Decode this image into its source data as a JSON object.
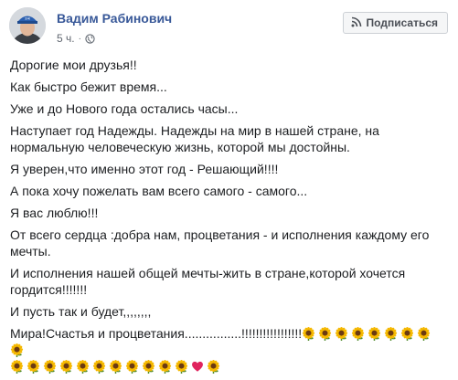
{
  "author": {
    "name": "Вадим Рабинович"
  },
  "post_meta": {
    "time": "5 ч.",
    "separator": "·",
    "privacy_icon": "globe-icon"
  },
  "subscribe_button": {
    "label": "Подписаться",
    "icon": "rss-icon"
  },
  "paragraphs": [
    "Дорогие мои друзья!!",
    "Как быстро бежит время...",
    "Уже и до Нового года остались часы...",
    "Наступает год Надежды. Надежды на мир в нашей стране, на нормальную человеческую жизнь, которой мы достойны.",
    "Я уверен,что именно этот год - Решающий!!!!",
    "А пока хочу пожелать вам всего самого - самого...",
    "Я вас люблю!!!",
    "От всего сердца :добра нам, процветания - и исполнения каждому его мечты.",
    "И исполнения нашей общей мечты-жить в стране,которой хочется гордится!!!!!!!",
    "И пусть так и будет,,,,,,,,"
  ],
  "last_line": {
    "text": "Мира!Счастья и процветания................!!!!!!!!!!!!!!!!!",
    "emoji_line1_count": 9,
    "emoji_line2_before_heart": 11,
    "emoji_line2_after_heart": 1,
    "emoji_icon": "sunflower-icon",
    "heart_icon": "red-heart-icon"
  },
  "colors": {
    "author_link": "#385898",
    "meta": "#606770",
    "text": "#1c1e21",
    "heart": "#e0245e"
  }
}
